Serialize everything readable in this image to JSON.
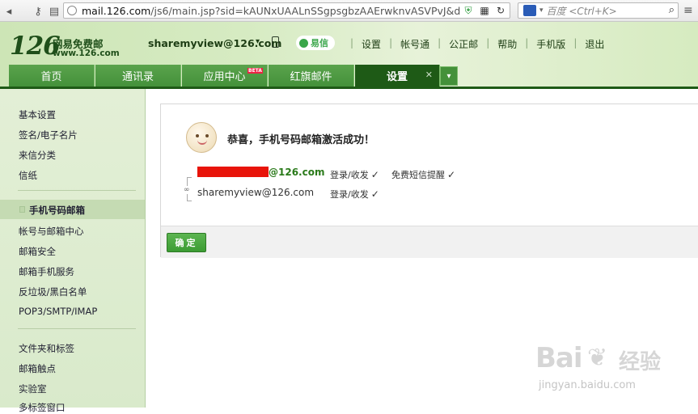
{
  "browser": {
    "url_host": "mail.126.com",
    "url_path": "/js6/main.jsp?sid=kAUNxUAALnSSgpsgbzAAErwknvASVPvJ&d",
    "search_placeholder": "百度 <Ctrl+K>"
  },
  "header": {
    "logo_number": "126",
    "logo_cn": "网易免费邮",
    "logo_url": "www.126.com",
    "account": "sharemyview@126.com",
    "yixin_label": "易信",
    "links": [
      "设置",
      "帐号通",
      "公正邮",
      "帮助",
      "手机版",
      "退出"
    ]
  },
  "tabs": [
    {
      "label": "首页"
    },
    {
      "label": "通讯录"
    },
    {
      "label": "应用中心",
      "badge": "BETA"
    },
    {
      "label": "红旗邮件"
    },
    {
      "label": "设置",
      "active": true
    }
  ],
  "sidebar": {
    "group1": [
      "基本设置",
      "签名/电子名片",
      "来信分类",
      "信纸"
    ],
    "group2": [
      "手机号码邮箱",
      "帐号与邮箱中心",
      "邮箱安全",
      "邮箱手机服务",
      "反垃圾/黑白名单",
      "POP3/SMTP/IMAP"
    ],
    "group3": [
      "文件夹和标签",
      "邮箱触点",
      "实验室",
      "多标签窗口"
    ]
  },
  "main": {
    "success_title": "恭喜，手机号码邮箱激活成功！",
    "phone_domain": "@126.com",
    "phone_tags": [
      "登录/收发",
      "免费短信提醒"
    ],
    "email": "sharemyview@126.com",
    "email_tags": [
      "登录/收发"
    ],
    "confirm_label": "确定"
  },
  "watermark": {
    "brand": "Bai",
    "brand_cn": "经验",
    "url": "jingyan.baidu.com"
  }
}
